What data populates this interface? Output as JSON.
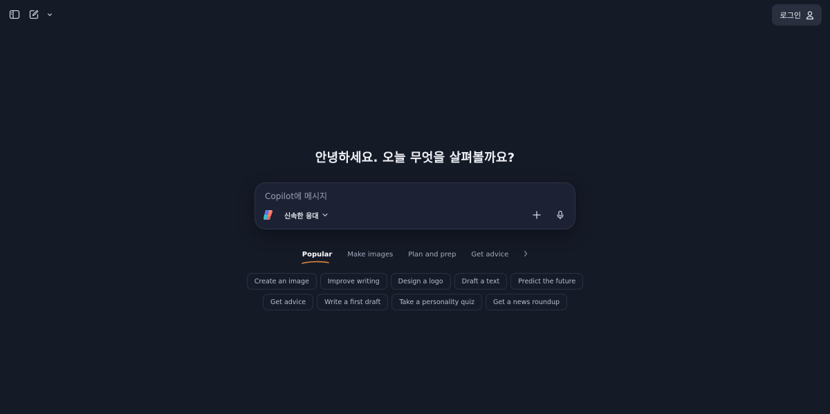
{
  "header": {
    "sidebar_icon": "sidebar-toggle-icon",
    "new_chat_icon": "compose-icon",
    "login_label": "로그인",
    "login_icon": "user-icon"
  },
  "main": {
    "greeting": "안녕하세요. 오늘 무엇을 살펴볼까요?"
  },
  "composer": {
    "placeholder": "Copilot에 메시지",
    "value": "",
    "mode_label": "신속한 응대",
    "logo_icon": "copilot-logo-icon",
    "add_icon": "plus-icon",
    "mic_icon": "microphone-icon"
  },
  "tabs": [
    {
      "label": "Popular",
      "active": true
    },
    {
      "label": "Make images",
      "active": false
    },
    {
      "label": "Plan and prep",
      "active": false
    },
    {
      "label": "Get advice",
      "active": false
    }
  ],
  "chips": {
    "row1": [
      "Create an image",
      "Improve writing",
      "Design a logo",
      "Draft a text",
      "Predict the future"
    ],
    "row2": [
      "Get advice",
      "Write a first draft",
      "Take a personality quiz",
      "Get a news roundup"
    ]
  },
  "colors": {
    "background": "#151a27",
    "composer_bg": "#1c2133",
    "accent_underline": "#e08a3c"
  }
}
